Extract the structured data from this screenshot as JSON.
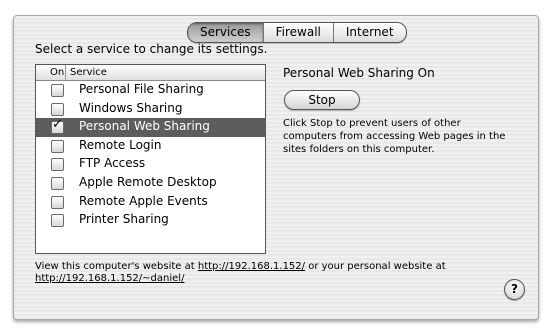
{
  "tabs": [
    {
      "label": "Services",
      "selected": true
    },
    {
      "label": "Firewall",
      "selected": false
    },
    {
      "label": "Internet",
      "selected": false
    }
  ],
  "prompt": "Select a service to change its settings.",
  "list": {
    "header_on": "On",
    "header_service": "Service",
    "items": [
      {
        "label": "Personal File Sharing",
        "checked": false,
        "selected": false
      },
      {
        "label": "Windows Sharing",
        "checked": false,
        "selected": false
      },
      {
        "label": "Personal Web Sharing",
        "checked": true,
        "selected": true
      },
      {
        "label": "Remote Login",
        "checked": false,
        "selected": false
      },
      {
        "label": "FTP Access",
        "checked": false,
        "selected": false
      },
      {
        "label": "Apple Remote Desktop",
        "checked": false,
        "selected": false
      },
      {
        "label": "Remote Apple Events",
        "checked": false,
        "selected": false
      },
      {
        "label": "Printer Sharing",
        "checked": false,
        "selected": false
      }
    ]
  },
  "detail": {
    "status": "Personal Web Sharing On",
    "stop_label": "Stop",
    "description": "Click Stop to prevent users of other computers from accessing Web pages in the sites folders on this computer."
  },
  "footer": {
    "text_1": "View this computer's website at ",
    "link_1": "http://192.168.1.152/",
    "text_2": " or your personal website at ",
    "link_2": "http://192.168.1.152/~daniel/"
  },
  "help_label": "?",
  "check_glyph": "✓"
}
